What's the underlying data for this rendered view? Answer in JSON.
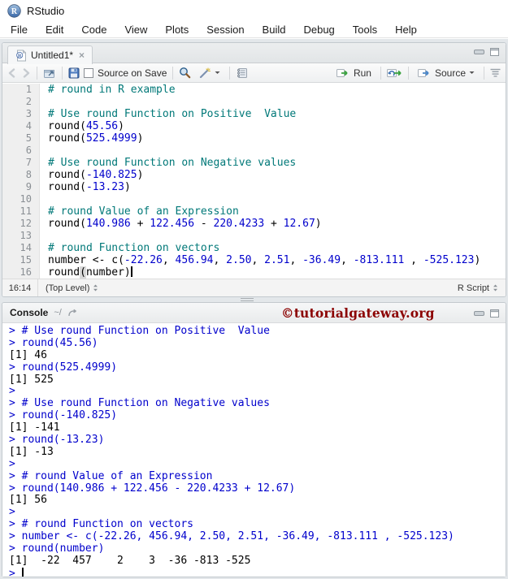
{
  "window": {
    "title": "RStudio"
  },
  "menu": {
    "items": [
      "File",
      "Edit",
      "Code",
      "View",
      "Plots",
      "Session",
      "Build",
      "Debug",
      "Tools",
      "Help"
    ]
  },
  "source_pane": {
    "tab": {
      "label": "Untitled1*",
      "close_glyph": "×"
    },
    "toolbar": {
      "source_on_save_label": "Source on Save",
      "run_label": "Run",
      "source_label": "Source"
    },
    "editor": {
      "lines": [
        {
          "n": 1,
          "seg": [
            [
              "c",
              "# round in R example"
            ]
          ]
        },
        {
          "n": 2,
          "seg": []
        },
        {
          "n": 3,
          "seg": [
            [
              "c",
              "# Use round Function on Positive  Value"
            ]
          ]
        },
        {
          "n": 4,
          "seg": [
            [
              "p",
              "round("
            ],
            [
              "n",
              "45.56"
            ],
            [
              "p",
              ")"
            ]
          ]
        },
        {
          "n": 5,
          "seg": [
            [
              "p",
              "round("
            ],
            [
              "n",
              "525.4999"
            ],
            [
              "p",
              ")"
            ]
          ]
        },
        {
          "n": 6,
          "seg": []
        },
        {
          "n": 7,
          "seg": [
            [
              "c",
              "# Use round Function on Negative values"
            ]
          ]
        },
        {
          "n": 8,
          "seg": [
            [
              "p",
              "round("
            ],
            [
              "n",
              "-140.825"
            ],
            [
              "p",
              ")"
            ]
          ]
        },
        {
          "n": 9,
          "seg": [
            [
              "p",
              "round("
            ],
            [
              "n",
              "-13.23"
            ],
            [
              "p",
              ")"
            ]
          ]
        },
        {
          "n": 10,
          "seg": []
        },
        {
          "n": 11,
          "seg": [
            [
              "c",
              "# round Value of an Expression"
            ]
          ]
        },
        {
          "n": 12,
          "seg": [
            [
              "p",
              "round("
            ],
            [
              "n",
              "140.986"
            ],
            [
              "p",
              " + "
            ],
            [
              "n",
              "122.456"
            ],
            [
              "p",
              " - "
            ],
            [
              "n",
              "220.4233"
            ],
            [
              "p",
              " + "
            ],
            [
              "n",
              "12.67"
            ],
            [
              "p",
              ")"
            ]
          ]
        },
        {
          "n": 13,
          "seg": []
        },
        {
          "n": 14,
          "seg": [
            [
              "c",
              "# round Function on vectors"
            ]
          ]
        },
        {
          "n": 15,
          "seg": [
            [
              "p",
              "number <- c("
            ],
            [
              "n",
              "-22.26"
            ],
            [
              "p",
              ", "
            ],
            [
              "n",
              "456.94"
            ],
            [
              "p",
              ", "
            ],
            [
              "n",
              "2.50"
            ],
            [
              "p",
              ", "
            ],
            [
              "n",
              "2.51"
            ],
            [
              "p",
              ", "
            ],
            [
              "n",
              "-36.49"
            ],
            [
              "p",
              ", "
            ],
            [
              "n",
              "-813.111"
            ],
            [
              "p",
              " , "
            ],
            [
              "n",
              "-525.123"
            ],
            [
              "p",
              ")"
            ]
          ]
        },
        {
          "n": 16,
          "seg": [
            [
              "p",
              "round"
            ],
            [
              "h",
              "("
            ],
            [
              "p",
              "number)"
            ]
          ],
          "cursor": true
        }
      ]
    },
    "status_bar": {
      "cursor_position": "16:14",
      "scope": "(Top Level)",
      "file_type": "R Script"
    }
  },
  "console_pane": {
    "title": "Console",
    "path": "~/",
    "watermark": "©tutorialgateway.org",
    "prompt": "> ",
    "lines": [
      {
        "kind": "in",
        "text": "# Use round Function on Positive  Value"
      },
      {
        "kind": "in",
        "text": "round(45.56)"
      },
      {
        "kind": "out",
        "text": "[1] 46"
      },
      {
        "kind": "in",
        "text": "round(525.4999)"
      },
      {
        "kind": "out",
        "text": "[1] 525"
      },
      {
        "kind": "in",
        "text": ""
      },
      {
        "kind": "in",
        "text": "# Use round Function on Negative values"
      },
      {
        "kind": "in",
        "text": "round(-140.825)"
      },
      {
        "kind": "out",
        "text": "[1] -141"
      },
      {
        "kind": "in",
        "text": "round(-13.23)"
      },
      {
        "kind": "out",
        "text": "[1] -13"
      },
      {
        "kind": "in",
        "text": ""
      },
      {
        "kind": "in",
        "text": "# round Value of an Expression"
      },
      {
        "kind": "in",
        "text": "round(140.986 + 122.456 - 220.4233 + 12.67)"
      },
      {
        "kind": "out",
        "text": "[1] 56"
      },
      {
        "kind": "in",
        "text": ""
      },
      {
        "kind": "in",
        "text": "# round Function on vectors"
      },
      {
        "kind": "in",
        "text": "number <- c(-22.26, 456.94, 2.50, 2.51, -36.49, -813.111 , -525.123)"
      },
      {
        "kind": "in",
        "text": "round(number)"
      },
      {
        "kind": "out",
        "text": "[1]  -22  457    2    3  -36 -813 -525"
      },
      {
        "kind": "prompt",
        "text": ""
      }
    ]
  },
  "colors": {
    "comment": "#007878",
    "number": "#0000CC",
    "console_input": "#0000CC",
    "watermark": "#8B0000",
    "run_arrow_green": "#3AA23F",
    "source_arrow_blue": "#4A86C8"
  }
}
